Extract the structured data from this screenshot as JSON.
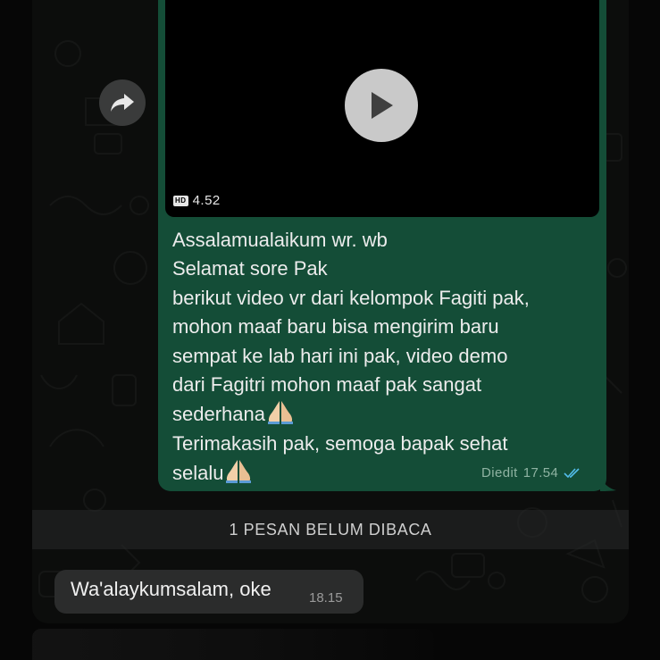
{
  "outgoing_message": {
    "video": {
      "quality_badge": "HD",
      "duration": "4.52"
    },
    "lines": [
      "Assalamualaikum wr. wb",
      "Selamat sore Pak",
      "berikut video vr dari kelompok Fagiti pak,",
      "mohon maaf baru bisa mengirim baru",
      "sempat ke lab hari ini pak, video demo",
      "dari Fagitri mohon maaf pak sangat",
      "sederhana",
      "Terimakasih pak, semoga bapak sehat",
      "selalu"
    ],
    "edited_label": "Diedit",
    "time": "17.54",
    "status_icon": "double-check-read-icon"
  },
  "unread_banner": "1 PESAN BELUM DIBACA",
  "incoming_message": {
    "text": "Wa'alaykumsalam, oke",
    "time": "18.15"
  },
  "icons": {
    "forward": "forward-arrow-icon",
    "play": "play-icon",
    "prayer_emoji": "folded-hands-emoji"
  },
  "colors": {
    "outgoing_bubble": "#144d37",
    "incoming_bubble": "#2b2c2c",
    "read_ticks": "#53bdeb"
  }
}
